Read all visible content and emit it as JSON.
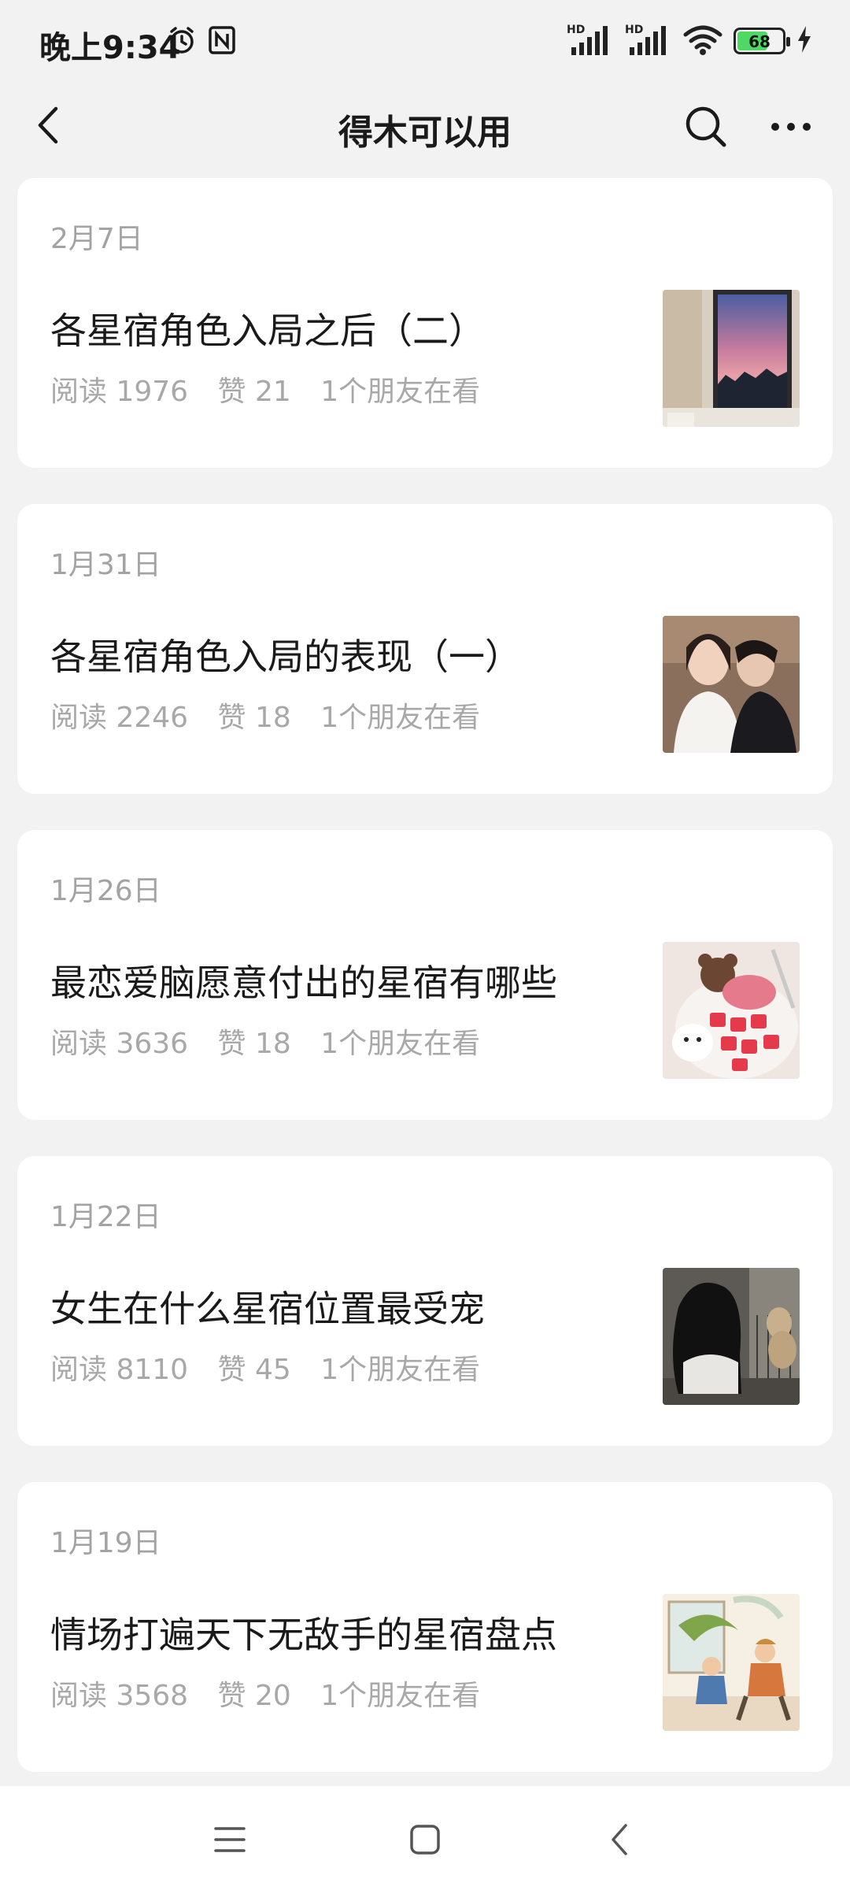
{
  "status_bar": {
    "time": "晚上9:34",
    "signal_label_1": "HD",
    "signal_label_2": "HD",
    "battery_level": "68"
  },
  "header": {
    "title": "得木可以用"
  },
  "articles": [
    {
      "date": "2月7日",
      "title": "各星宿角色入局之后（二）",
      "reads": "阅读 1976",
      "likes": "赞 21",
      "friends": "1个朋友在看",
      "thumb_icon": "sunset-window-photo"
    },
    {
      "date": "1月31日",
      "title": "各星宿角色入局的表现（一）",
      "reads": "阅读 2246",
      "likes": "赞 18",
      "friends": "1个朋友在看",
      "thumb_icon": "couple-photo"
    },
    {
      "date": "1月26日",
      "title": "最恋爱脑愿意付出的星宿有哪些",
      "reads": "阅读 3636",
      "likes": "赞 18",
      "friends": "1个朋友在看",
      "thumb_icon": "strawberry-dessert-photo"
    },
    {
      "date": "1月22日",
      "title": "女生在什么星宿位置最受宠",
      "reads": "阅读 8110",
      "likes": "赞 45",
      "friends": "1个朋友在看",
      "thumb_icon": "girl-with-dog-photo"
    },
    {
      "date": "1月19日",
      "title": "情场打遍天下无敌手的星宿盘点",
      "reads": "阅读 3568",
      "likes": "赞 20",
      "friends": "1个朋友在看",
      "thumb_icon": "illustration-photo"
    }
  ],
  "colors": {
    "background": "#f2f2f2",
    "card": "#ffffff",
    "muted_text": "#a3a3a3",
    "battery_fill": "#4cd964"
  }
}
